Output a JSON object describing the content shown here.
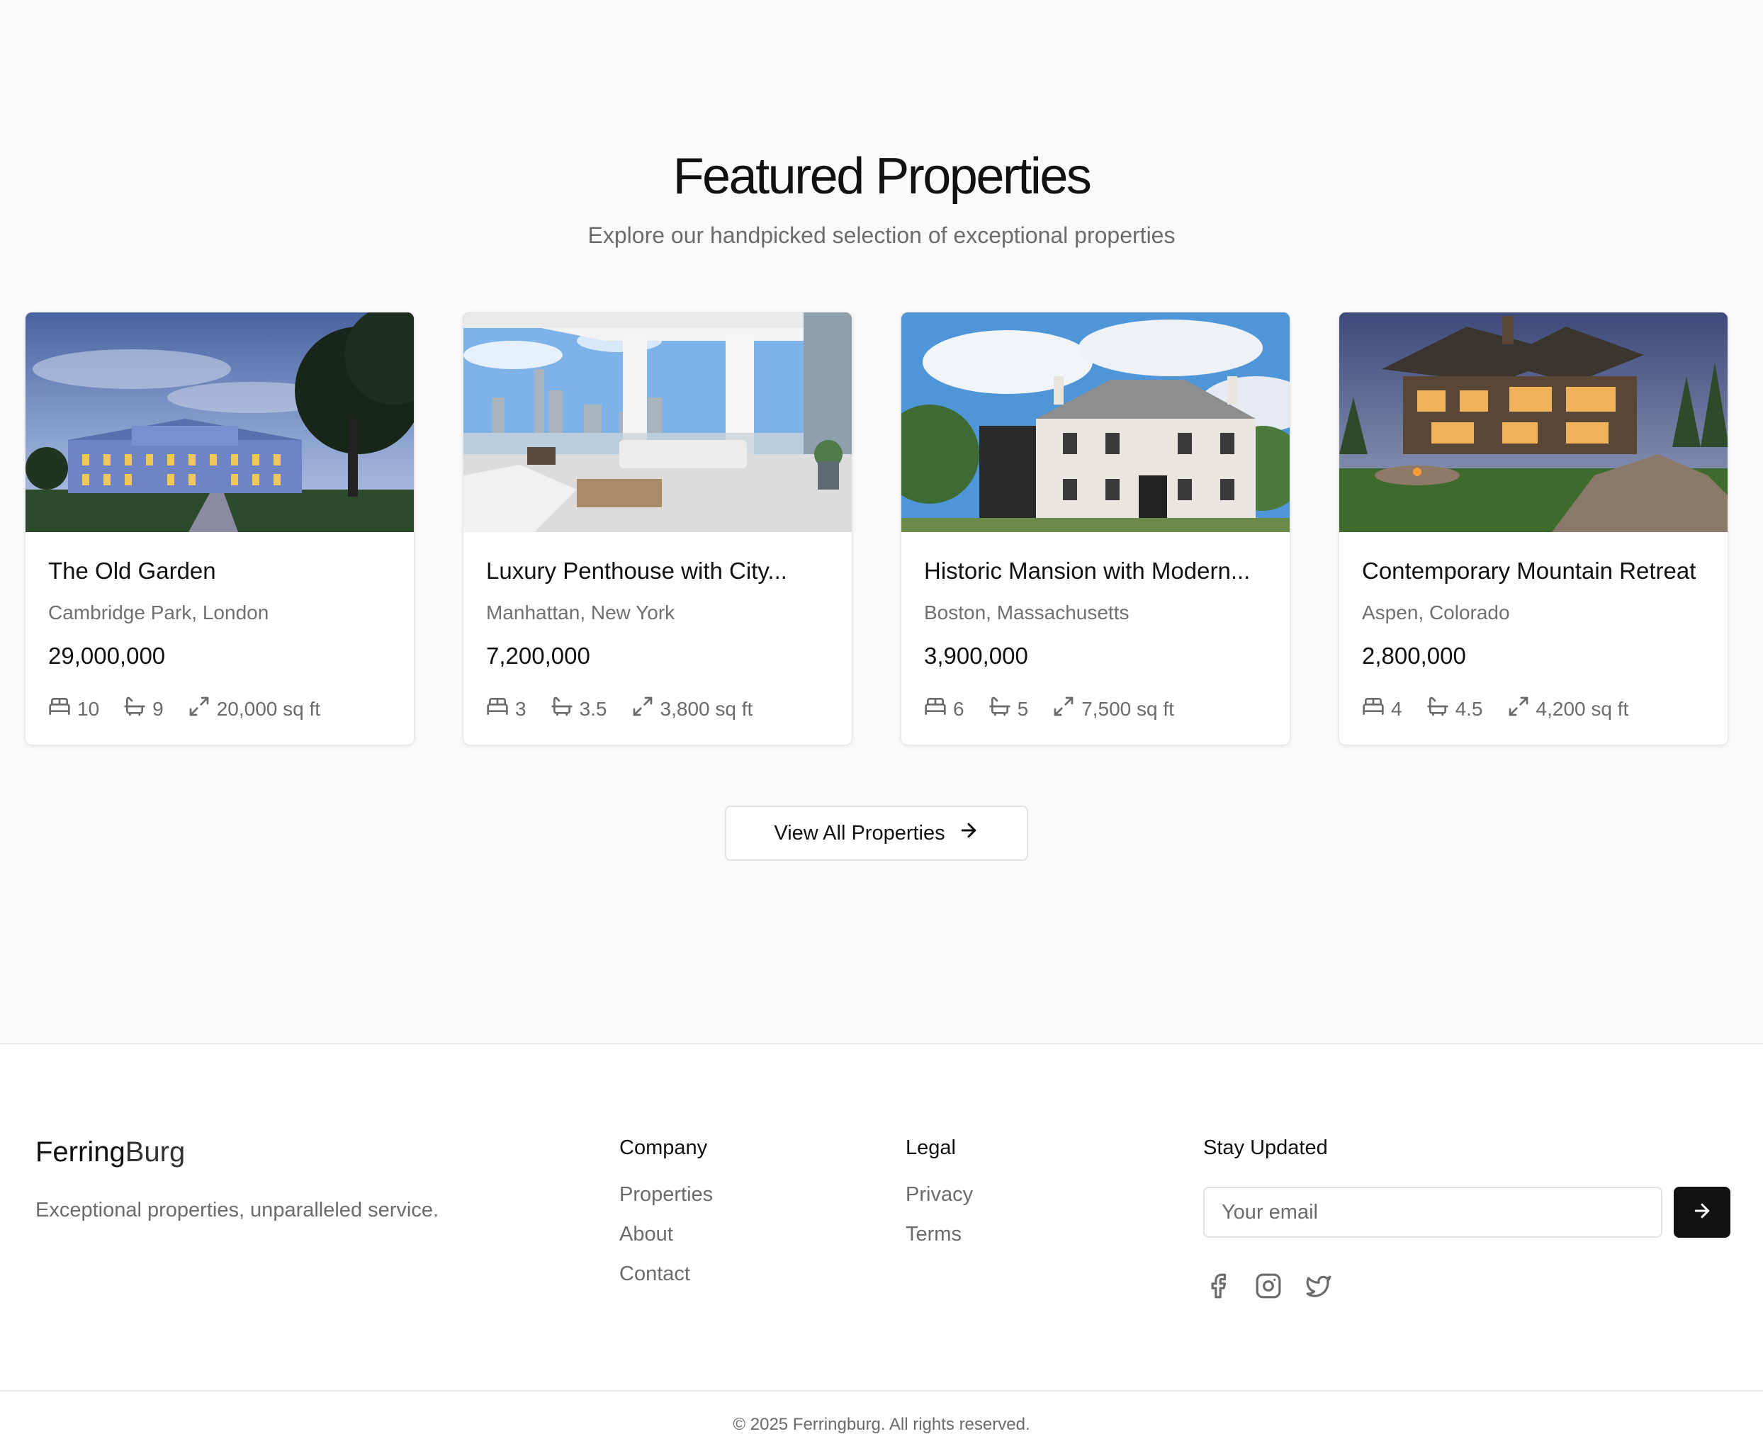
{
  "featured": {
    "title": "Featured Properties",
    "subtitle": "Explore our handpicked selection of exceptional properties",
    "cta_label": "View All Properties",
    "properties": [
      {
        "title": "The Old Garden",
        "location": "Cambridge Park, London",
        "price": "29,000,000",
        "beds": "10",
        "baths": "9",
        "area": "20,000 sq ft"
      },
      {
        "title": "Luxury Penthouse with City...",
        "location": "Manhattan, New York",
        "price": "7,200,000",
        "beds": "3",
        "baths": "3.5",
        "area": "3,800 sq ft"
      },
      {
        "title": "Historic Mansion with Modern...",
        "location": "Boston, Massachusetts",
        "price": "3,900,000",
        "beds": "6",
        "baths": "5",
        "area": "7,500 sq ft"
      },
      {
        "title": "Contemporary Mountain Retreat",
        "location": "Aspen, Colorado",
        "price": "2,800,000",
        "beds": "4",
        "baths": "4.5",
        "area": "4,200 sq ft"
      }
    ]
  },
  "footer": {
    "brand_bold": "Ferring",
    "brand_light": "Burg",
    "tagline": "Exceptional properties, unparalleled service.",
    "company": {
      "heading": "Company",
      "links": [
        "Properties",
        "About",
        "Contact"
      ]
    },
    "legal": {
      "heading": "Legal",
      "links": [
        "Privacy",
        "Terms"
      ]
    },
    "newsletter": {
      "heading": "Stay Updated",
      "placeholder": "Your email"
    },
    "copyright": "© 2025 Ferringburg. All rights reserved."
  },
  "icons": {
    "beds": "bed-icon",
    "baths": "bath-icon",
    "area": "expand-icon",
    "cta": "arrow-right-icon",
    "social": [
      "facebook-icon",
      "instagram-icon",
      "twitter-icon"
    ]
  },
  "colors": {
    "page_bg": "#fafafa",
    "text": "#111111",
    "muted": "#6b6b6b",
    "border": "#e3e3e3",
    "button_dark": "#111111"
  }
}
